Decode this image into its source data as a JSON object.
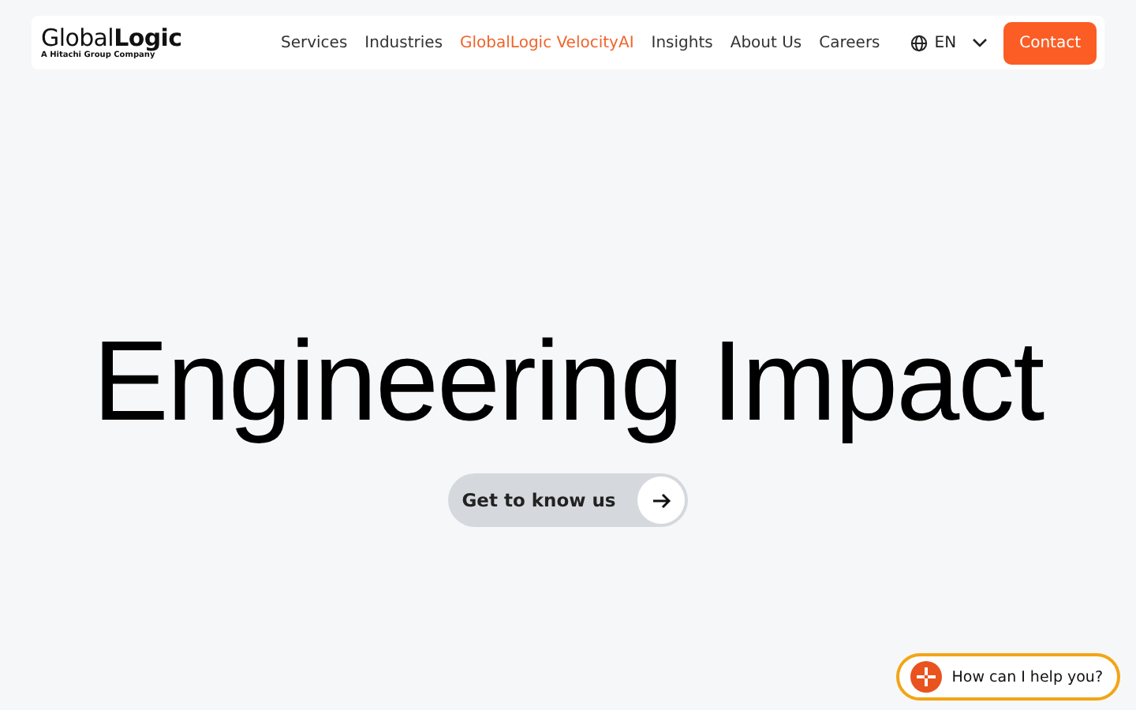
{
  "header": {
    "logo": "Global**Logic**",
    "tagline": "A Hitachi Group Company",
    "nav": [
      {
        "label": "Services",
        "selected": false
      },
      {
        "label": "Industries",
        "selected": false
      },
      {
        "label": "GlobalLogic VelocityAI",
        "selected": true
      },
      {
        "label": "Insights",
        "selected": false
      },
      {
        "label": "About Us",
        "selected": false
      },
      {
        "label": "Careers",
        "selected": false
      }
    ],
    "language": "EN",
    "contact": "Contact"
  },
  "hero": {
    "title": "Engineering Impact",
    "cta": "Get to know us"
  },
  "chat": {
    "label": "How can I help you?"
  }
}
